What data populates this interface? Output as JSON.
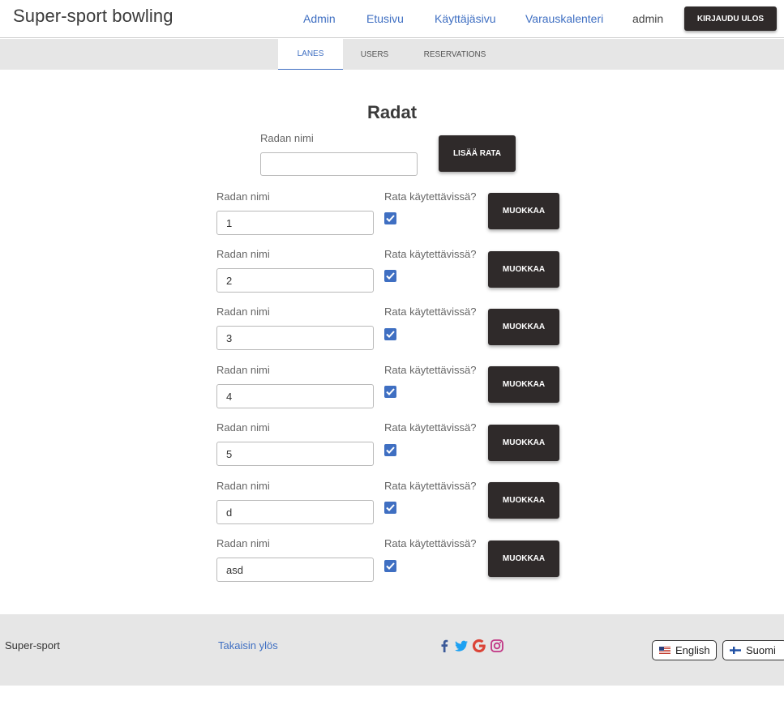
{
  "header": {
    "brand": "Super-sport bowling",
    "nav": [
      "Admin",
      "Etusivu",
      "Käyttäjäsivu",
      "Varauskalenteri"
    ],
    "user": "admin",
    "logout_label": "KIRJAUDU ULOS"
  },
  "tabs": [
    {
      "label": "LANES",
      "active": true
    },
    {
      "label": "USERS",
      "active": false
    },
    {
      "label": "RESERVATIONS",
      "active": false
    }
  ],
  "main": {
    "title": "Radat",
    "add_label": "Radan nimi",
    "add_value": "",
    "add_button": "LISÄÄ RATA",
    "lanes": [
      {
        "label": "Radan nimi",
        "value": "1",
        "available_label": "Rata käytettävissä?",
        "available": true,
        "button": "MUOKKAA"
      },
      {
        "label": "Radan nimi",
        "value": "2",
        "available_label": "Rata käytettävissä?",
        "available": true,
        "button": "MUOKKAA"
      },
      {
        "label": "Radan nimi",
        "value": "3",
        "available_label": "Rata käytettävissä?",
        "available": true,
        "button": "MUOKKAA"
      },
      {
        "label": "Radan nimi",
        "value": "4",
        "available_label": "Rata käytettävissä?",
        "available": true,
        "button": "MUOKKAA"
      },
      {
        "label": "Radan nimi",
        "value": "5",
        "available_label": "Rata käytettävissä?",
        "available": true,
        "button": "MUOKKAA"
      },
      {
        "label": "Radan nimi",
        "value": "d",
        "available_label": "Rata käytettävissä?",
        "available": true,
        "button": "MUOKKAA"
      },
      {
        "label": "Radan nimi",
        "value": "asd",
        "available_label": "Rata käytettävissä?",
        "available": true,
        "button": "MUOKKAA"
      }
    ]
  },
  "footer": {
    "copyright": "Super-sport",
    "back_to_top": "Takaisin ylös",
    "social_icons": [
      "facebook-icon",
      "twitter-icon",
      "google-icon",
      "instagram-icon"
    ],
    "languages": [
      "English",
      "Suomi"
    ]
  },
  "colors": {
    "accent": "#3f6fc2",
    "button_dark": "#2f2a2a",
    "bar_gray": "#e6e6e6",
    "facebook": "#3b5998",
    "twitter": "#1da1f2",
    "google": "#db4437",
    "instagram": "#c13584"
  }
}
